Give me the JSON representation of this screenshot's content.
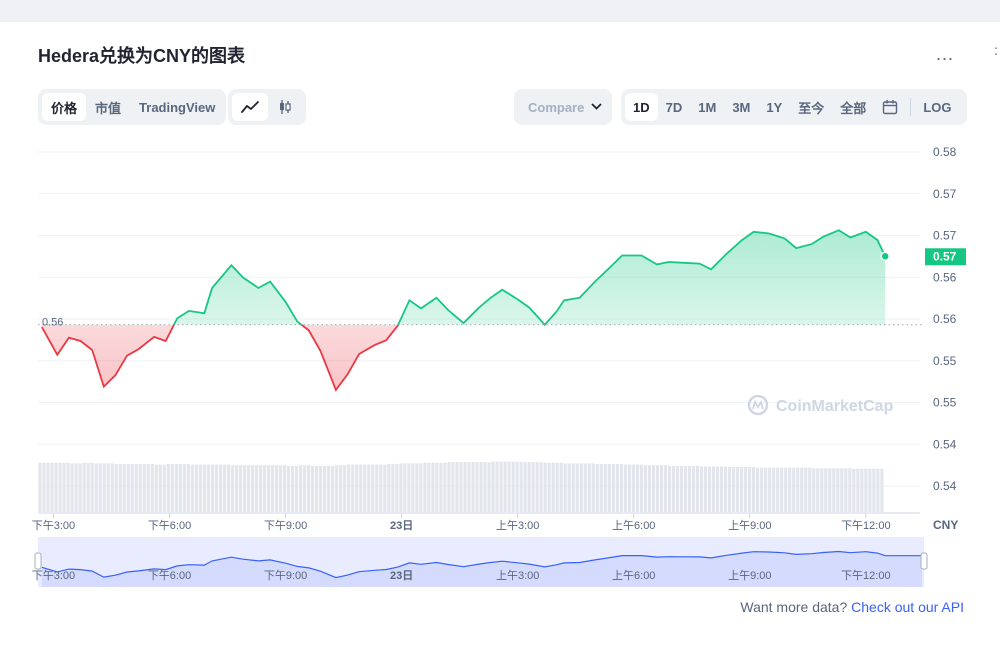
{
  "header": {
    "title": "Hedera兑换为CNY的图表",
    "more_label": "..."
  },
  "type_tabs": [
    {
      "label": "价格",
      "active": true
    },
    {
      "label": "市值",
      "active": false
    },
    {
      "label": "TradingView",
      "active": false
    }
  ],
  "chart_style": {
    "line_icon": "line-chart-icon",
    "candle_icon": "candlestick-icon"
  },
  "compare": {
    "label": "Compare",
    "icon": "chevron-down-icon"
  },
  "range_tabs": [
    {
      "label": "1D",
      "active": true
    },
    {
      "label": "7D",
      "active": false
    },
    {
      "label": "1M",
      "active": false
    },
    {
      "label": "3M",
      "active": false
    },
    {
      "label": "1Y",
      "active": false
    },
    {
      "label": "至今",
      "active": false
    },
    {
      "label": "全部",
      "active": false
    }
  ],
  "range_extra": {
    "calendar_icon": "calendar-icon",
    "log_label": "LOG"
  },
  "footer": {
    "text": "Want more data?",
    "link": "Check out our API"
  },
  "watermark": "CoinMarketCap",
  "colors": {
    "up": "#16c784",
    "down": "#ea3943",
    "accent": "#3861fb"
  },
  "chart_data": {
    "type": "line",
    "title": "",
    "currency_label": "CNY",
    "open_label": "0.56",
    "last_label": "0.57",
    "y_tick_labels": [
      "0.58",
      "0.57",
      "0.57",
      "0.56",
      "0.56",
      "0.55",
      "0.55",
      "0.54",
      "0.54"
    ],
    "ylim": [
      0.541,
      0.582
    ],
    "open_value": 0.5608,
    "x_tick_labels": [
      "下午3:00",
      "下午6:00",
      "下午9:00",
      "23日",
      "上午3:00",
      "上午6:00",
      "上午9:00",
      "下午12:00"
    ],
    "x_tick_hours": [
      3,
      6,
      9,
      12,
      15,
      18,
      21,
      24
    ],
    "x_range_hours": [
      2.6,
      25.4
    ],
    "navigator_labels": [
      "下午3:00",
      "下午6:00",
      "下午9:00",
      "23日",
      "上午3:00",
      "上午6:00",
      "上午9:00",
      "下午12:00"
    ],
    "grid": true,
    "series": [
      {
        "hours": [
          2.7,
          3.1,
          3.4,
          3.7,
          4.0,
          4.3,
          4.6,
          4.9,
          5.2,
          5.6,
          5.9,
          6.2,
          6.5,
          6.9,
          7.1,
          7.6,
          7.9,
          8.3,
          8.6,
          9.0,
          9.3,
          9.6,
          9.9,
          10.3,
          10.6,
          10.9,
          11.3,
          11.6,
          11.9,
          12.2,
          12.5,
          12.9,
          13.2,
          13.6,
          14.0,
          14.3,
          14.6,
          15.0,
          15.3,
          15.7,
          16.0,
          16.2,
          16.6,
          17.0,
          17.4,
          17.7,
          18.2,
          18.6,
          18.9,
          19.3,
          19.7,
          20.0,
          20.4,
          20.8,
          21.1,
          21.5,
          21.9,
          22.2,
          22.6,
          22.9,
          23.3,
          23.6,
          24.0,
          24.3,
          24.5
        ],
        "values": [
          0.5605,
          0.5571,
          0.5592,
          0.5588,
          0.5577,
          0.5532,
          0.5546,
          0.557,
          0.5578,
          0.5593,
          0.5588,
          0.5616,
          0.5625,
          0.5622,
          0.5653,
          0.5681,
          0.5666,
          0.5653,
          0.5661,
          0.5636,
          0.5612,
          0.5601,
          0.5576,
          0.5528,
          0.5547,
          0.5572,
          0.5583,
          0.5589,
          0.5607,
          0.5638,
          0.5628,
          0.5641,
          0.5626,
          0.561,
          0.5629,
          0.5641,
          0.5651,
          0.5639,
          0.5629,
          0.5608,
          0.5624,
          0.5638,
          0.5641,
          0.5661,
          0.5679,
          0.5693,
          0.5693,
          0.5682,
          0.5685,
          0.5684,
          0.5683,
          0.5676,
          0.5695,
          0.5712,
          0.5722,
          0.572,
          0.5714,
          0.5702,
          0.5707,
          0.5716,
          0.5724,
          0.5715,
          0.5722,
          0.5712,
          0.5692
        ],
        "volume": [
          0.82,
          0.82,
          0.81,
          0.82,
          0.81,
          0.81,
          0.8,
          0.8,
          0.8,
          0.79,
          0.8,
          0.8,
          0.79,
          0.79,
          0.79,
          0.78,
          0.78,
          0.78,
          0.78,
          0.77,
          0.78,
          0.77,
          0.77,
          0.78,
          0.79,
          0.79,
          0.79,
          0.8,
          0.81,
          0.81,
          0.82,
          0.82,
          0.83,
          0.83,
          0.83,
          0.84,
          0.84,
          0.83,
          0.83,
          0.82,
          0.82,
          0.81,
          0.81,
          0.8,
          0.8,
          0.79,
          0.78,
          0.78,
          0.77,
          0.77,
          0.76,
          0.76,
          0.75,
          0.75,
          0.74,
          0.74,
          0.74,
          0.74,
          0.73,
          0.73,
          0.73,
          0.72,
          0.72,
          0.72,
          0.72
        ]
      }
    ]
  }
}
